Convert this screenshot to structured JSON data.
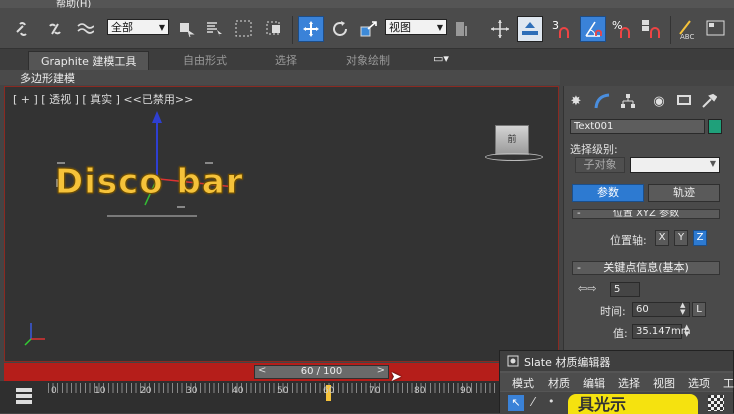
{
  "menu": {
    "help": "帮助(H)"
  },
  "toolbar": {
    "selection_filter": "全部",
    "ref_coord": "视图",
    "icons": [
      "link-icon",
      "unlink-icon",
      "bind-spacewarp-icon",
      "select-object-icon",
      "select-by-name-icon",
      "rect-selection-icon",
      "window-crossing-icon",
      "move-icon",
      "rotate-icon",
      "scale-icon",
      "named-selection-icon",
      "mirror-icon",
      "align-icon",
      "layer-manager-icon",
      "snap-3-icon",
      "angle-snap-icon",
      "percent-snap-icon",
      "spinner-snap-icon",
      "edit-named-selections-icon"
    ]
  },
  "ribbon": {
    "tabs": [
      "Graphite 建模工具",
      "自由形式",
      "选择",
      "对象绘制"
    ],
    "subtab": "多边形建模"
  },
  "viewport": {
    "label": "[ + ] [ 透视 ] [ 真实 ] <<已禁用>>",
    "text_object": "Disco bar",
    "viewcube_face": "前"
  },
  "timeline": {
    "current": "60 / 100",
    "prev": "<",
    "next": ">",
    "ticks": [
      "0",
      "10",
      "20",
      "30",
      "40",
      "50",
      "60",
      "70",
      "80",
      "90"
    ]
  },
  "panel": {
    "object_name": "Text001",
    "selection_level_label": "选择级别:",
    "sub_object_label": "子对象",
    "tab_params": "参数",
    "tab_track": "轨迹",
    "rollout_xyz": "位置 XYZ 参数",
    "position_axis_label": "位置轴:",
    "axes": [
      "X",
      "Y",
      "Z"
    ],
    "rollout_key_info": "关键点信息(基本)",
    "key_index": "5",
    "time_label": "时间:",
    "time_value": "60",
    "lock_label": "L",
    "value_label": "值:",
    "value_value": "35.147mm",
    "object_color": "#1fa07a"
  },
  "slate": {
    "title": "Slate 材质编辑器",
    "menu": [
      "模式",
      "材质",
      "编辑",
      "选择",
      "视图",
      "选项",
      "工"
    ],
    "preview_text": "具光示"
  },
  "colors": {
    "accent_blue": "#2d7ad1",
    "timebar_red": "#b51e1a",
    "viewport_border": "#8a2a22",
    "text_gold": "#f5c23a"
  }
}
